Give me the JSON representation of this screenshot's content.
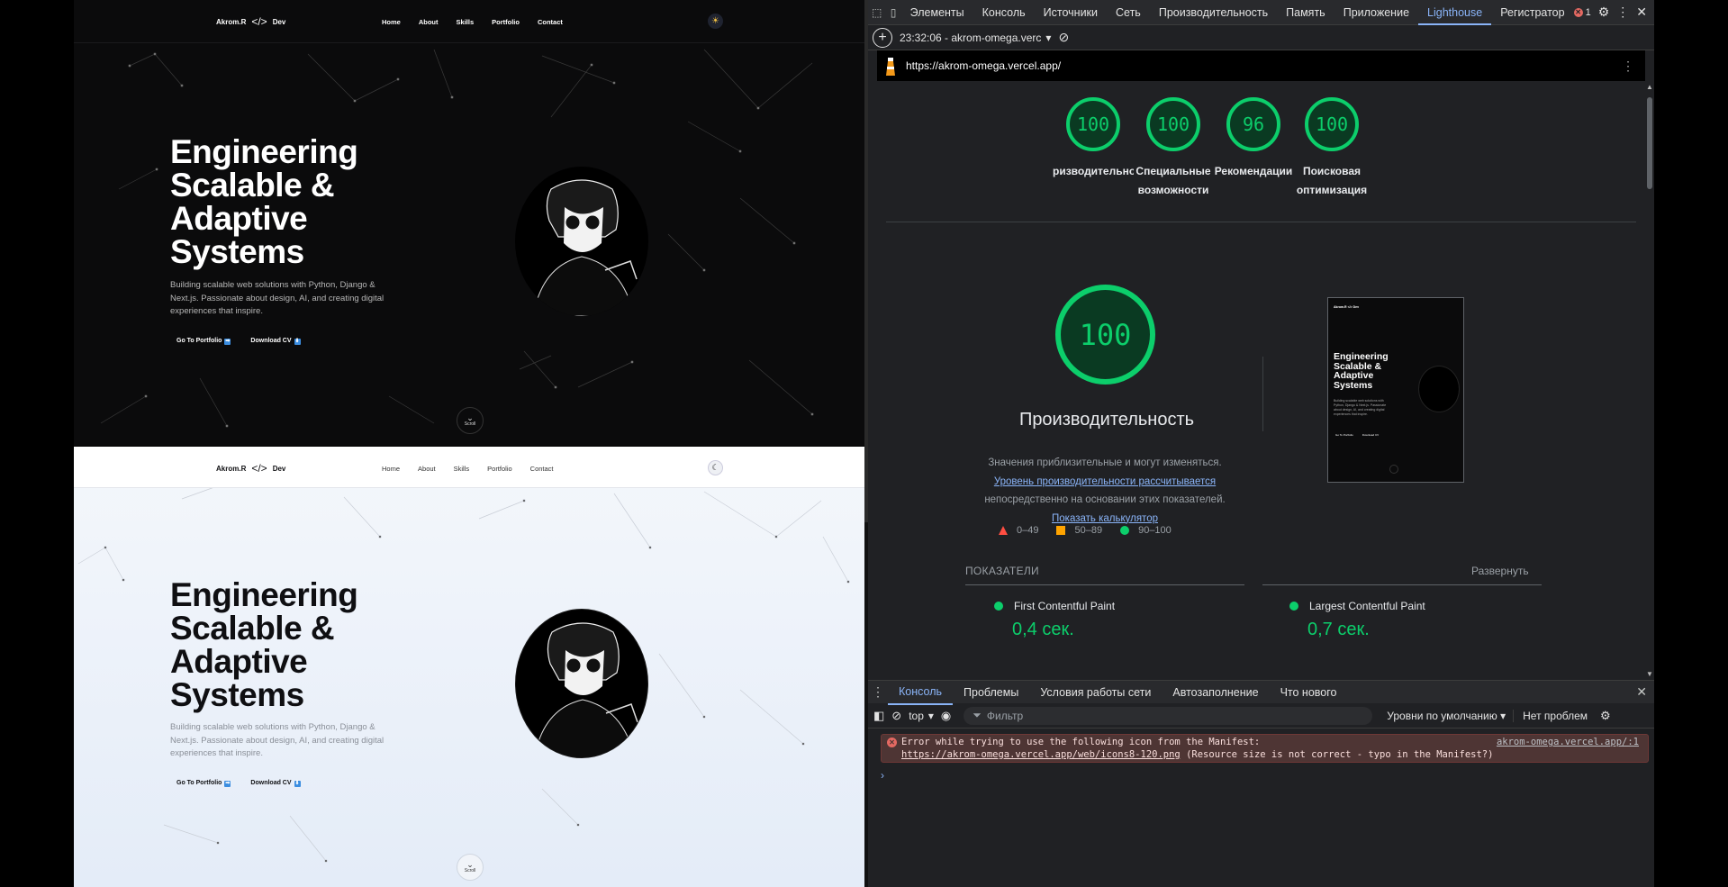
{
  "site": {
    "logo_name": "Akrom.R",
    "logo_code": "</>",
    "logo_suffix": "Dev",
    "nav": [
      "Home",
      "About",
      "Skills",
      "Portfolio",
      "Contact"
    ],
    "hero_lines": [
      "Engineering",
      "Scalable &",
      "Adaptive",
      "Systems"
    ],
    "description": "Building scalable web solutions with Python, Django & Next.js. Passionate about design, AI, and creating digital experiences that inspire.",
    "cta_portfolio": "Go To Portfolio",
    "cta_cv": "Download CV",
    "scroll_label": "Scroll",
    "scroll_chevron": "⌄",
    "dark_theme_icon": "sun-icon",
    "light_theme_icon": "moon-icon"
  },
  "devtools": {
    "tabs": [
      "Элементы",
      "Консоль",
      "Источники",
      "Сеть",
      "Производительность",
      "Память",
      "Приложение",
      "Lighthouse",
      "Регистратор"
    ],
    "active_tab": "Lighthouse",
    "error_count": "1",
    "report_selector": "23:32:06 - akrom-omega.verc",
    "url": "https://akrom-omega.vercel.app/",
    "scores": [
      {
        "value": "100",
        "label": "ризводительно"
      },
      {
        "value": "100",
        "label": "Специальные возможности"
      },
      {
        "value": "96",
        "label": "Рекомендации"
      },
      {
        "value": "100",
        "label": "Поисковая оптимизация"
      }
    ],
    "perf_score": "100",
    "perf_title": "Производительность",
    "perf_desc_1": "Значения приблизительные и могут изменяться.",
    "perf_desc_link1": "Уровень производительности рассчитывается",
    "perf_desc_2": "непосредственно на основании этих показателей.",
    "perf_desc_link2": "Показать калькулятор",
    "legend": [
      "0–49",
      "50–89",
      "90–100"
    ],
    "metrics_heading": "ПОКАЗАТЕЛИ",
    "expand_label": "Развернуть",
    "metrics": [
      {
        "name": "First Contentful Paint",
        "value": "0,4 сек."
      },
      {
        "name": "Largest Contentful Paint",
        "value": "0,7 сек."
      }
    ],
    "drawer_tabs": [
      "Консоль",
      "Проблемы",
      "Условия работы сети",
      "Автозаполнение",
      "Что нового"
    ],
    "active_drawer_tab": "Консоль",
    "context": "top",
    "filter_placeholder": "Фильтр",
    "levels": "Уровни по умолчанию",
    "no_issues": "Нет проблем",
    "error_line1": "Error while trying to use the following icon from the Manifest:",
    "error_link": "https://akrom-omega.vercel.app/web/icons8-120.png",
    "error_line2_rest": " (Resource size is not correct - typo in the Manifest?)",
    "error_source": "akrom-omega.vercel.app/:1",
    "console_prompt": "›",
    "colors": {
      "pass": "#0cce6b",
      "average": "#ffa400",
      "fail": "#ff4e42",
      "accent": "#8ab4f8"
    }
  }
}
